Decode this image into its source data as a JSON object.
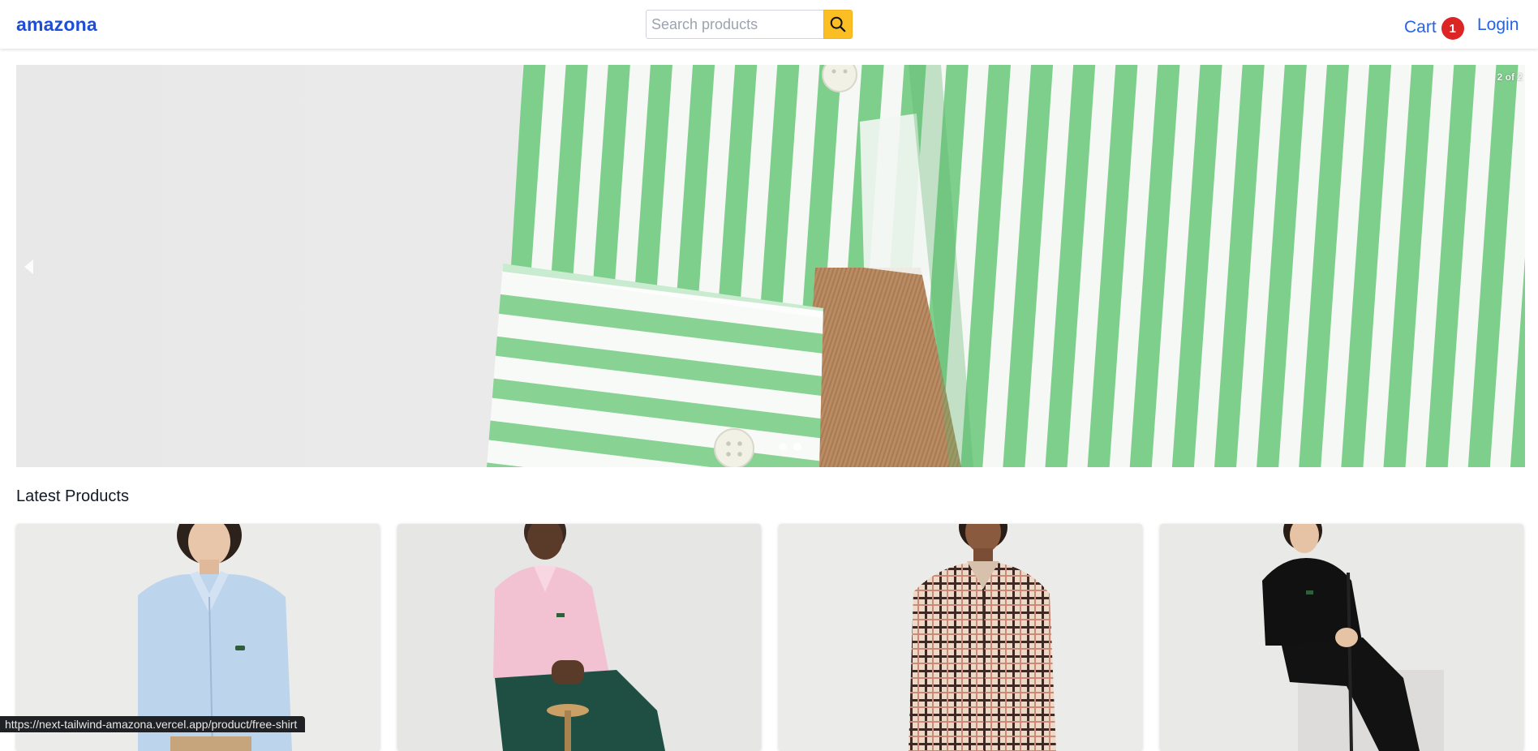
{
  "header": {
    "brand": "amazona",
    "search": {
      "placeholder": "Search products",
      "value": ""
    },
    "search_button_icon": "search-icon",
    "cart": {
      "label": "Cart",
      "count": "1"
    },
    "login_label": "Login"
  },
  "carousel": {
    "counter": "2 of 2",
    "current_slide": 2,
    "total_slides": 2,
    "slide_image": "green-white-striped-shirt-sleeve"
  },
  "latest": {
    "title": "Latest Products",
    "products": [
      {
        "image": "man-light-blue-shirt"
      },
      {
        "image": "man-pink-shirt-seated"
      },
      {
        "image": "man-plaid-shirt"
      },
      {
        "image": "man-black-polo-seated"
      }
    ]
  },
  "status_bar": {
    "url": "https://next-tailwind-amazona.vercel.app/product/free-shirt"
  },
  "colors": {
    "brand": "#1d4ed8",
    "link": "#2563eb",
    "accent": "#fbbf24",
    "badge": "#dc2626"
  }
}
